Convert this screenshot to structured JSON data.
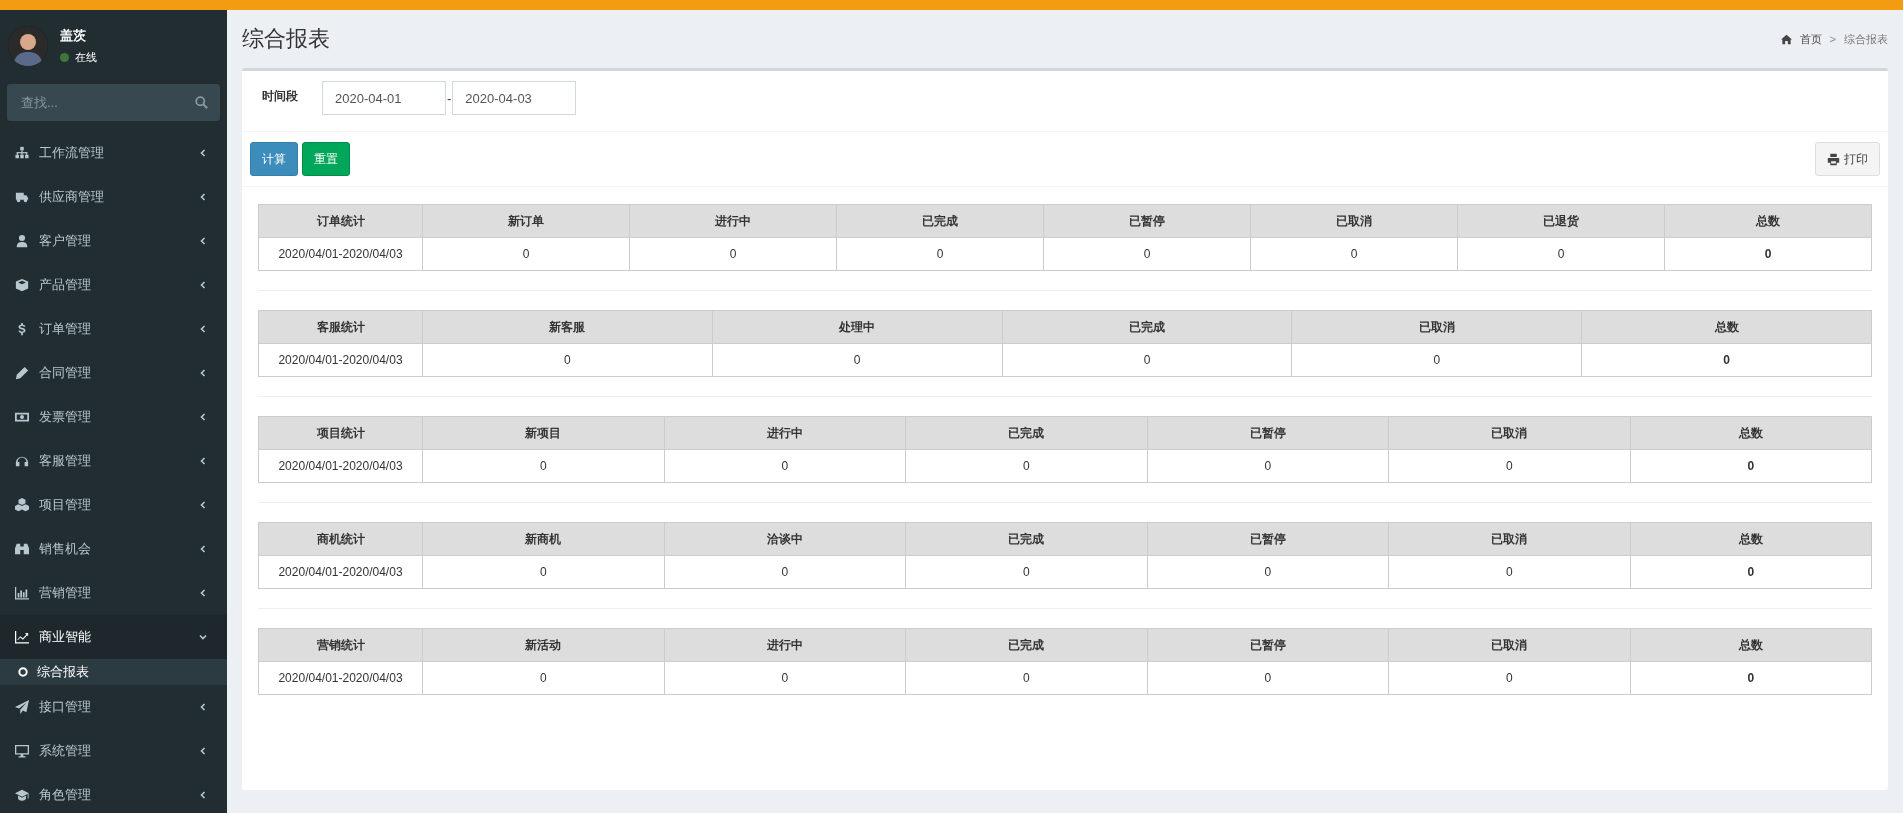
{
  "sidebar": {
    "user": {
      "name": "盖茨",
      "status": "在线"
    },
    "search": {
      "placeholder": "查找..."
    },
    "items": [
      {
        "label": "工作流管理",
        "expanded": false
      },
      {
        "label": "供应商管理",
        "expanded": false
      },
      {
        "label": "客户管理",
        "expanded": false
      },
      {
        "label": "产品管理",
        "expanded": false
      },
      {
        "label": "订单管理",
        "expanded": false
      },
      {
        "label": "合同管理",
        "expanded": false
      },
      {
        "label": "发票管理",
        "expanded": false
      },
      {
        "label": "客服管理",
        "expanded": false
      },
      {
        "label": "项目管理",
        "expanded": false
      },
      {
        "label": "销售机会",
        "expanded": false
      },
      {
        "label": "营销管理",
        "expanded": false
      },
      {
        "label": "商业智能",
        "expanded": true,
        "children": [
          {
            "label": "综合报表",
            "selected": true
          }
        ]
      },
      {
        "label": "接口管理",
        "expanded": false
      },
      {
        "label": "系统管理",
        "expanded": false
      },
      {
        "label": "角色管理",
        "expanded": false
      }
    ]
  },
  "page": {
    "title": "综合报表",
    "breadcrumb": [
      "首页",
      "综合报表"
    ],
    "breadcrumb_separator": ">"
  },
  "filter": {
    "label": "时间段",
    "from": "2020-04-01",
    "separator": "-",
    "to": "2020-04-03"
  },
  "buttons": {
    "calculate": "计算",
    "reset": "重置",
    "print": "打印"
  },
  "tables": [
    {
      "columns": [
        "订单统计",
        "新订单",
        "进行中",
        "已完成",
        "已暂停",
        "已取消",
        "已退货",
        "总数"
      ],
      "row": [
        "2020/04/01-2020/04/03",
        "0",
        "0",
        "0",
        "0",
        "0",
        "0",
        "0"
      ]
    },
    {
      "columns": [
        "客服统计",
        "新客服",
        "处理中",
        "已完成",
        "已取消",
        "总数"
      ],
      "row": [
        "2020/04/01-2020/04/03",
        "0",
        "0",
        "0",
        "0",
        "0"
      ]
    },
    {
      "columns": [
        "项目统计",
        "新项目",
        "进行中",
        "已完成",
        "已暂停",
        "已取消",
        "总数"
      ],
      "row": [
        "2020/04/01-2020/04/03",
        "0",
        "0",
        "0",
        "0",
        "0",
        "0"
      ]
    },
    {
      "columns": [
        "商机统计",
        "新商机",
        "洽谈中",
        "已完成",
        "已暂停",
        "已取消",
        "总数"
      ],
      "row": [
        "2020/04/01-2020/04/03",
        "0",
        "0",
        "0",
        "0",
        "0",
        "0"
      ]
    },
    {
      "columns": [
        "营销统计",
        "新活动",
        "进行中",
        "已完成",
        "已暂停",
        "已取消",
        "总数"
      ],
      "row": [
        "2020/04/01-2020/04/03",
        "0",
        "0",
        "0",
        "0",
        "0",
        "0"
      ]
    }
  ]
}
